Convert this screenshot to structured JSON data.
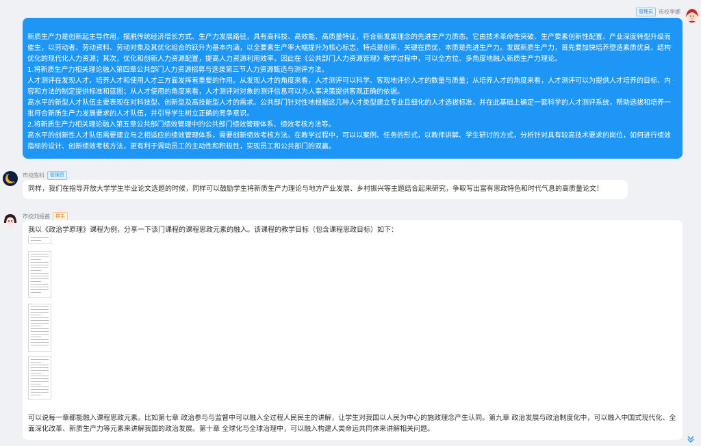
{
  "messages": [
    {
      "sender": "市校李娜",
      "badge": "管理员",
      "align": "right",
      "paragraphs": [
        "新质生产力是创新起主导作用，摆脱传统经济增长方式、生产力发展路径，具有高科技、高效能、高质量特征，符合新发展理念的先进生产力质态。它由技术革命性突破、生产要素创新性配置、产业深度转型升级而催生，以劳动者、劳动资料、劳动对象及其优化组合的跃升为基本内涵，以全要素生产率大幅提升为核心标志，特点是创新，关键在质优，本质是先进生产力。发展新质生产力，首先要加快培养塑造素质优良、结构优化的现代化人力资源；其次，优化和创新人力资源配置，提高人力资源利用效率。因此在《公共部门人力资源管理》教学过程中，可以全方位、多角度地融入新质生产力理论。",
        "1.将新质生产力相关理论融入第四章公共部门人力资源招募与选录第三节人力资源甄选与测评方法。",
        "人才测评在发现人才、培养人才和使用人才三方面发挥着重要的作用。从发现人才的角度来看，人才测评可以科学、客观地评价人才的数量与质量；从培养人才的角度来看，人才测评可以为提供人才培养的目标、内容和方法的制定提供标准和蓝图；从人才使用的角度来看，人才测评对对象的测评信息可以为人事决策提供客观正确的依据。",
        "高水平的新型人才队伍主要表现在对科技型、创新型及高技能型人才的需求。公共部门针对性地根据这几种人才类型建立专业且细化的人才选拔标准，并在此基础上确定一套科学的人才测评系统，帮助选拔和培养一批符合新质生产力发展要求的人才队伍，并引导学生树立正确的竞争意识。",
        "2.将新质生产力相关理论融入第五章公共部门绩效管理中的公共部门绩效管理体系、绩效考核方法等。",
        "高水平的创新性人才队伍需要建立与之相适应的绩效管理体系，需要创新绩效考核方法。在教学过程中，可以以案例、任务的形式，以教师讲解、学生研讨的方式，分析针对具有较高技术要求的岗位，如何进行绩效指标的设计、创新绩效考核方法，更有利于调动员工的主动性和积极性，实现员工和公共部门的双赢。"
      ]
    },
    {
      "sender": "市校陈科",
      "badge": "管理员",
      "align": "left",
      "text": "同样，我们在指导开放大学学生毕业论文选题的时候，同样可以鼓励学生将新质生产力理论与地方产业发展、乡村振兴等主题结合起来研究，争取写出富有思政特色和时代气息的高质量论文！"
    },
    {
      "sender": "市校刘娅茜",
      "badge": "群主",
      "align": "left",
      "intro": "我以《政治学原理》课程为例，分享一下该门课程的课程思政元素的融入。该课程的教学目标（包含课程思政目标）如下：",
      "outro": "可以说每一章都能融入课程思政元素。比如第七章 政治参与与监督中可以融入全过程人民民主的讲解，让学生对我国以人民为中心的施政理念产生认同。第九章 政治发展与政治制度化中，可以融入中国式现代化、全面深化改革、新质生产力等元素来讲解我国的政治发展。第十章 全球化与全球治理中，可以融入构建人类命运共同体来讲解相关问题。"
    }
  ],
  "icons": {
    "scroll_down": "double-chevron-down-icon"
  },
  "colors": {
    "bubble_self": "#1e96f5",
    "background": "#f0f1f4",
    "admin_badge": "#2b8ce6",
    "owner_badge": "#e08b2b"
  }
}
